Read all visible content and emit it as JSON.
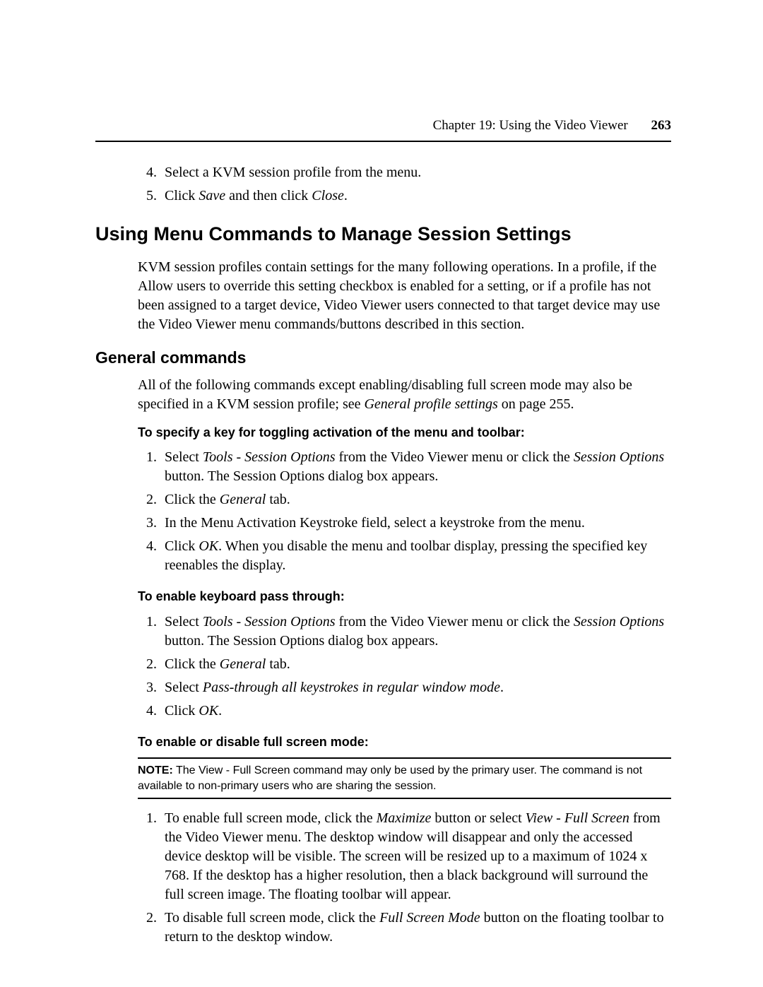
{
  "header": {
    "chapter": "Chapter 19: Using the Video Viewer",
    "page": "263"
  },
  "intro_steps": {
    "s4": "Select a KVM session profile from the menu.",
    "s5_a": "Click ",
    "s5_save": "Save",
    "s5_b": " and then click ",
    "s5_close": "Close",
    "s5_c": "."
  },
  "h1": "Using Menu Commands to Manage Session Settings",
  "p1": "KVM session profiles contain settings for the many following operations. In a profile, if the Allow users to override this setting checkbox is enabled for a setting, or if a profile has not been assigned to a target device, Video Viewer users connected to that target device may use the Video Viewer menu commands/buttons described in this section.",
  "h2": "General commands",
  "p2_a": "All of the following commands except enabling/disabling full screen mode may also be specified in a KVM session profile; see ",
  "p2_em": "General profile settings",
  "p2_b": " on page 255.",
  "sub1": "To specify a key for toggling activation of the menu and toolbar:",
  "sec1": {
    "s1_a": "Select ",
    "s1_em1": "Tools - Session Options",
    "s1_b": " from the Video Viewer menu or click the ",
    "s1_em2": "Session Options",
    "s1_c": " button. The Session Options dialog box appears.",
    "s2_a": "Click the ",
    "s2_em": "General",
    "s2_b": " tab.",
    "s3": "In the Menu Activation Keystroke field, select a keystroke from the menu.",
    "s4_a": "Click ",
    "s4_em": "OK",
    "s4_b": ". When you disable the menu and toolbar display, pressing the specified key reenables the display."
  },
  "sub2": "To enable keyboard pass through:",
  "sec2": {
    "s1_a": "Select ",
    "s1_em1": "Tools - Session Options",
    "s1_b": " from the Video Viewer menu or click the ",
    "s1_em2": "Session Options",
    "s1_c": " button. The Session Options dialog box appears.",
    "s2_a": "Click the ",
    "s2_em": "General",
    "s2_b": " tab.",
    "s3_a": "Select ",
    "s3_em": "Pass-through all keystrokes in regular window mode",
    "s3_b": ".",
    "s4_a": "Click ",
    "s4_em": "OK",
    "s4_b": "."
  },
  "sub3": "To enable or disable full screen mode:",
  "note": {
    "label": "NOTE:",
    "text": " The View - Full Screen command may only be used by the primary user. The command is not available to non-primary users who are sharing the session."
  },
  "sec3": {
    "s1_a": "To enable full screen mode, click the ",
    "s1_em1": "Maximize",
    "s1_b": " button or select ",
    "s1_em2": "View - Full Screen",
    "s1_c": " from the Video Viewer menu. The desktop window will disappear and only the accessed device desktop will be visible. The screen will be resized up to a maximum of 1024 x 768. If the desktop has a higher resolution, then a black background will surround the full screen image. The floating toolbar will appear.",
    "s2_a": "To disable full screen mode, click the ",
    "s2_em": "Full Screen Mode",
    "s2_b": " button on the floating toolbar to return to the desktop window."
  }
}
